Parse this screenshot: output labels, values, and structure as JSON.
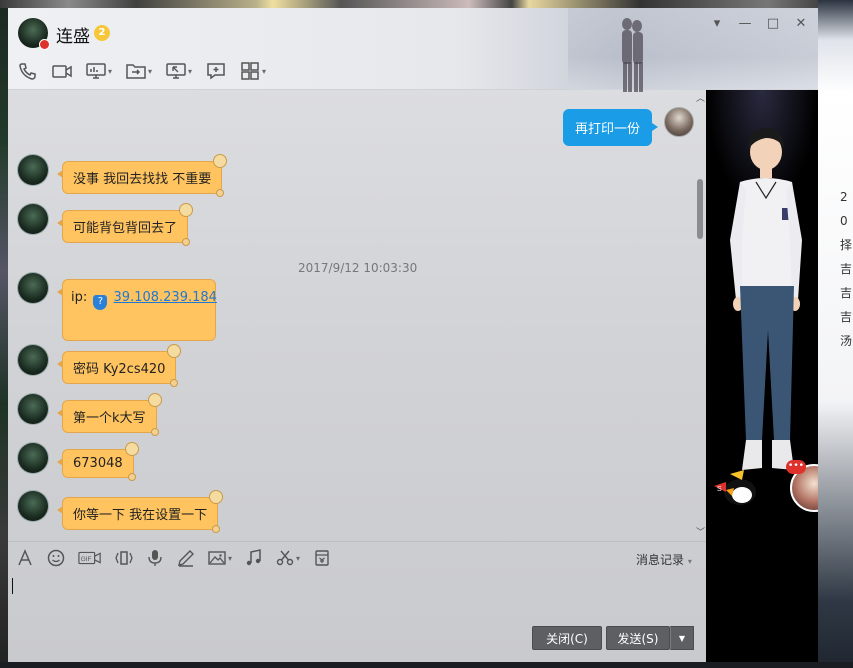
{
  "header": {
    "contact_name": "连盛",
    "vip_badge": "2"
  },
  "window_controls": {
    "minimize": "—",
    "maximize": "□",
    "close": "✕"
  },
  "toolbar": {
    "items": [
      "phone-icon",
      "video-icon",
      "screen-share-icon",
      "file-transfer-icon",
      "remote-assist-icon",
      "add-chat-icon",
      "apps-icon"
    ]
  },
  "messages": {
    "outgoing_1": "再打印一份",
    "incoming_1": "没事 我回去找找 不重要",
    "incoming_2": "可能背包背回去了",
    "timestamp": "2017/9/12 10:03:30",
    "ip_prefix": "ip:",
    "ip_value": "39.108.239.184",
    "incoming_4": "密码 Ky2cs420",
    "incoming_5": "第一个k大写",
    "incoming_6": "673048",
    "incoming_7": "你等一下 我在设置一下"
  },
  "input_toolbar": {
    "items": [
      "font-icon",
      "emoji-icon",
      "gif-icon",
      "shake-icon",
      "voice-icon",
      "pen-icon",
      "image-icon",
      "music-icon",
      "scissors-icon",
      "store-icon"
    ],
    "history_label": "消息记录"
  },
  "input": {
    "value": ""
  },
  "buttons": {
    "close_label": "关闭(C)",
    "send_label": "发送(S)"
  },
  "desktop_right_text": "2 0 择 吉 吉 吉 汤",
  "colors": {
    "incoming_bubble": "#ffc45f",
    "outgoing_bubble": "#1a9ce6",
    "button_bg": "#5d5f63",
    "link": "#1e78d4"
  }
}
